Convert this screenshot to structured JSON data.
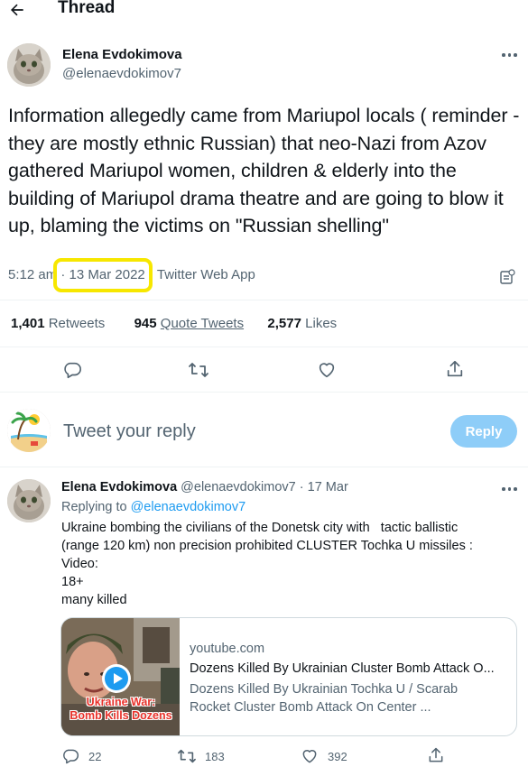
{
  "header": {
    "title": "Thread"
  },
  "tweet": {
    "author_name": "Elena Evdokimova",
    "author_handle": "@elenaevdokimov7",
    "text": "Information allegedly came from Mariupol locals ( reminder - they are mostly ethnic Russian) that neo-Nazi from Azov gathered Mariupol women, children & elderly into the building of Mariupol drama theatre and are going to blow it up, blaming the victims on \"Russian shelling\"",
    "time": "5:12 am",
    "sep": "·",
    "date": "13 Mar 2022",
    "source": "Twitter Web App",
    "retweets_count": "1,401",
    "retweets_label": "Retweets",
    "quote_count": "945",
    "quote_label": "Quote Tweets",
    "likes_count": "2,577",
    "likes_label": "Likes"
  },
  "reply_box": {
    "placeholder": "Tweet your reply",
    "button_label": "Reply"
  },
  "reply": {
    "author_name": "Elena Evdokimova",
    "author_handle": "@elenaevdokimov7",
    "date": "· 17 Mar",
    "replying_to_label": "Replying to",
    "replying_to_handle": "@elenaevdokimov7",
    "lines": [
      "Ukraine bombing the civilians of the Donetsk city with   tactic ballistic",
      "(range 120 km) non precision prohibited CLUSTER Tochka U missiles :",
      "Video:",
      "18+",
      "many killed"
    ],
    "card": {
      "domain": "youtube.com",
      "title": "Dozens Killed By Ukrainian Cluster Bomb Attack O...",
      "desc_line1": "Dozens Killed By Ukrainian Tochka U / Scarab",
      "desc_line2": "Rocket Cluster Bomb Attack On Center ...",
      "thumb_caption_1": "Ukraine War:",
      "thumb_caption_2": "Bomb Kills Dozens"
    },
    "reply_count": "22",
    "retweet_count": "183",
    "like_count": "392"
  },
  "colors": {
    "accent": "#1d9bf0",
    "highlight": "#f7e700",
    "muted": "#536471"
  }
}
